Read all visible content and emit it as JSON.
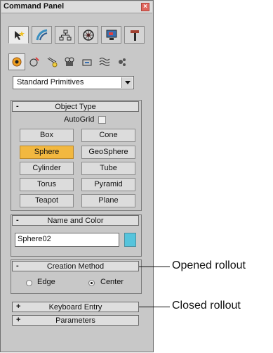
{
  "panel": {
    "title": "Command Panel",
    "close_icon": "close-icon",
    "tabs": [
      {
        "name": "create",
        "icon": "cursor-star-icon"
      },
      {
        "name": "modify",
        "icon": "curve-icon"
      },
      {
        "name": "hierarchy",
        "icon": "hierarchy-icon"
      },
      {
        "name": "motion",
        "icon": "motion-wheel-icon"
      },
      {
        "name": "display",
        "icon": "monitor-icon"
      },
      {
        "name": "utilities",
        "icon": "hammer-icon"
      }
    ],
    "subcategories": [
      {
        "name": "geometry",
        "icon": "sphere-icon"
      },
      {
        "name": "shapes",
        "icon": "shapes-icon"
      },
      {
        "name": "lights",
        "icon": "light-icon"
      },
      {
        "name": "cameras",
        "icon": "camera-icon"
      },
      {
        "name": "helpers",
        "icon": "helper-icon"
      },
      {
        "name": "space-warps",
        "icon": "wave-icon"
      },
      {
        "name": "systems",
        "icon": "gear-icon"
      }
    ],
    "dropdown": {
      "value": "Standard Primitives"
    }
  },
  "object_type": {
    "sign": "-",
    "title": "Object Type",
    "autogrid_label": "AutoGrid",
    "buttons": [
      "Box",
      "Cone",
      "Sphere",
      "GeoSphere",
      "Cylinder",
      "Tube",
      "Torus",
      "Pyramid",
      "Teapot",
      "Plane"
    ],
    "active_button": "Sphere"
  },
  "name_color": {
    "sign": "-",
    "title": "Name and Color",
    "name_value": "Sphere02",
    "color": "#56c4dc"
  },
  "creation_method": {
    "sign": "-",
    "title": "Creation Method",
    "options": [
      "Edge",
      "Center"
    ],
    "selected": "Center"
  },
  "keyboard_entry": {
    "sign": "+",
    "title": "Keyboard Entry"
  },
  "parameters": {
    "sign": "+",
    "title": "Parameters"
  },
  "callouts": {
    "opened": "Opened rollout",
    "closed": "Closed rollout"
  },
  "colors": {
    "panel_bg": "#c8c8c8",
    "active_button": "#f2b840",
    "close_red": "#e0665c"
  }
}
